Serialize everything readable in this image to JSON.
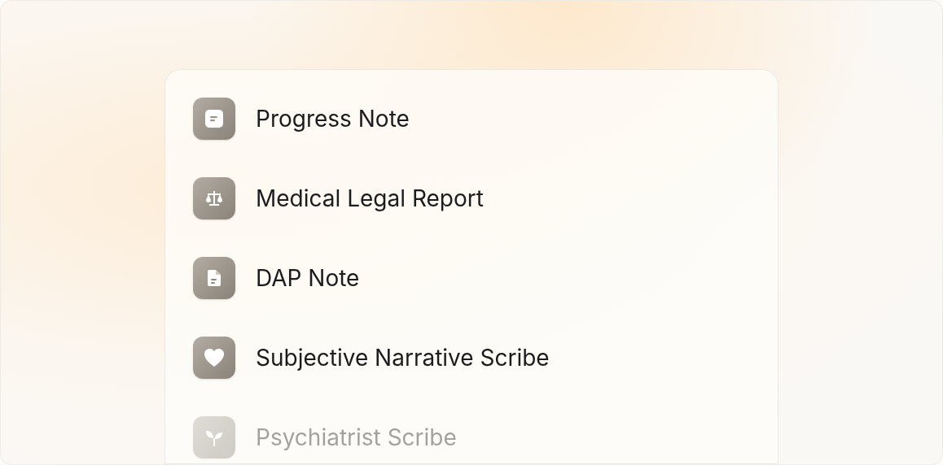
{
  "items": [
    {
      "label": "Progress Note",
      "kind": "note",
      "faded": false
    },
    {
      "label": "Medical Legal Report",
      "kind": "scale",
      "faded": false
    },
    {
      "label": "DAP Note",
      "kind": "file",
      "faded": false
    },
    {
      "label": "Subjective Narrative Scribe",
      "kind": "heart",
      "faded": false
    },
    {
      "label": "Psychiatrist Scribe",
      "kind": "sprout",
      "faded": true
    }
  ]
}
